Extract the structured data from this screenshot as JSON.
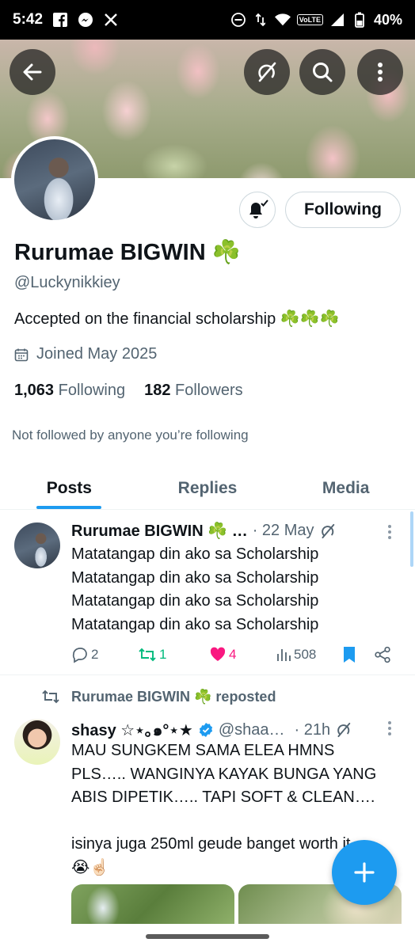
{
  "status_bar": {
    "time": "5:42",
    "network": "VoLTE",
    "battery": "40%"
  },
  "profile": {
    "name": "Rurumae BIGWIN ☘️",
    "handle": "@Luckynikkiey",
    "bio": "Accepted on the financial scholarship ☘️☘️☘️",
    "joined": "Joined May 2025",
    "following_count": "1,063",
    "following_label": "Following",
    "followers_count": "182",
    "followers_label": "Followers",
    "not_followed": "Not followed by anyone you’re following",
    "follow_button": "Following"
  },
  "tabs": [
    {
      "label": "Posts",
      "active": true
    },
    {
      "label": "Replies",
      "active": false
    },
    {
      "label": "Media",
      "active": false
    }
  ],
  "tweets": [
    {
      "author": "Rurumae BIGWIN ☘️ …",
      "time": "· 22 May",
      "lines": [
        "Matatangap din ako sa Scholarship",
        "Matatangap din ako sa Scholarship",
        "Matatangap din ako sa Scholarship",
        "Matatangap din ako sa Scholarship"
      ],
      "replies": "2",
      "reposts": "1",
      "likes": "4",
      "views": "508"
    },
    {
      "repost_label": "Rurumae BIGWIN ☘️ reposted",
      "author": "shasy ☆⋆｡๑°⋆★",
      "handle": "@shaa…",
      "time": "· 21h",
      "lines": [
        "MAU SUNGKEM SAMA ELEA HMNS",
        "PLS….. WANGINYA KAYAK BUNGA YANG",
        "ABIS DIPETIK….. TAPI SOFT & CLEAN….",
        "",
        "isinya juga 250ml geude banget worth it",
        "😭☝🏻"
      ]
    }
  ],
  "colors": {
    "accent": "#1d9bf0",
    "like": "#f91880",
    "repost": "#00ba7c",
    "muted": "#536471"
  }
}
